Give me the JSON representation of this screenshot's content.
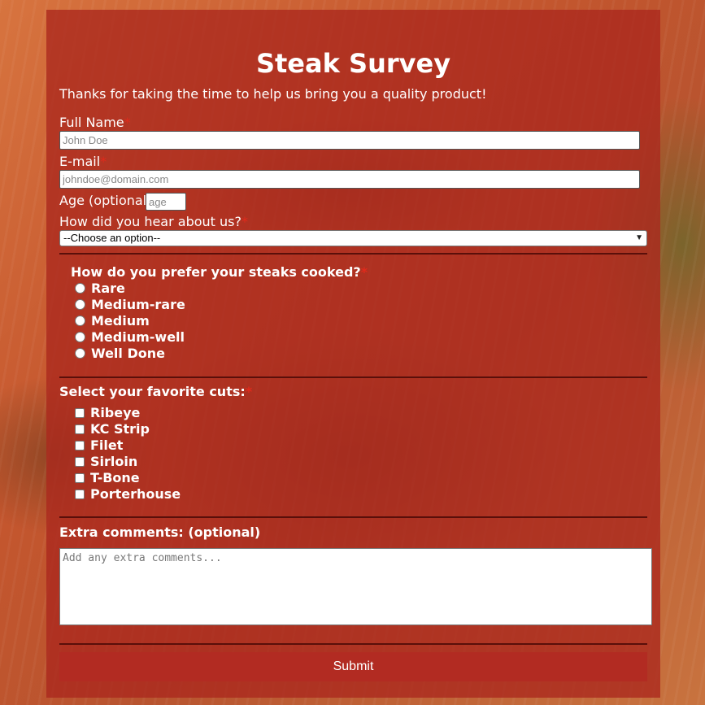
{
  "form": {
    "title": "Steak Survey",
    "intro": "Thanks for taking the time to help us bring you a quality product!",
    "required_mark": "*",
    "full_name": {
      "label": "Full Name",
      "placeholder": "John Doe"
    },
    "email": {
      "label": "E-mail",
      "placeholder": "johndoe@domain.com"
    },
    "age": {
      "label": "Age (optional)",
      "placeholder": "age"
    },
    "referral": {
      "label": "How did you hear about us?",
      "selected": "--Choose an option--"
    },
    "doneness": {
      "label": "How do you prefer your steaks cooked?",
      "options": [
        "Rare",
        "Medium-rare",
        "Medium",
        "Medium-well",
        "Well Done"
      ]
    },
    "cuts": {
      "label": "Select your favorite cuts:",
      "options": [
        "Ribeye",
        "KC Strip",
        "Filet",
        "Sirloin",
        "T-Bone",
        "Porterhouse"
      ]
    },
    "comments": {
      "label": "Extra comments: (optional)",
      "placeholder": "Add any extra comments..."
    },
    "submit_label": "Submit"
  },
  "colors": {
    "panel": "#aa281e",
    "required": "#e12a1c",
    "submit": "#b22b22",
    "divider": "#5a0f0a"
  }
}
